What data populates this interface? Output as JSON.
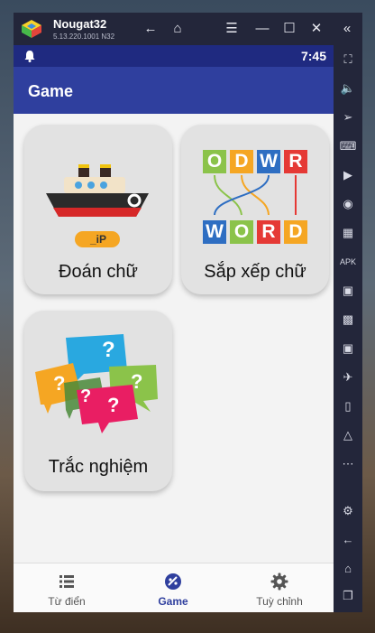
{
  "emulator": {
    "name": "Nougat32",
    "version": "5.13.220.1001 N32"
  },
  "status_bar": {
    "time": "7:45"
  },
  "app_bar": {
    "title": "Game"
  },
  "games": [
    {
      "label": "Đoán chữ",
      "icon": "ship-icon",
      "badge": "_iP"
    },
    {
      "label": "Sắp xếp chữ",
      "icon": "word-tiles-icon",
      "top_word": [
        "O",
        "D",
        "W",
        "R"
      ],
      "bottom_word": [
        "W",
        "O",
        "R",
        "D"
      ]
    },
    {
      "label": "Trắc nghiệm",
      "icon": "question-bubbles-icon",
      "marks": [
        "?",
        "?",
        "?",
        "?",
        "?"
      ]
    }
  ],
  "bottom_nav": [
    {
      "label": "Từ điển",
      "icon": "list-icon",
      "active": false
    },
    {
      "label": "Game",
      "icon": "game-icon",
      "active": true
    },
    {
      "label": "Tuỳ chỉnh",
      "icon": "gear-icon",
      "active": false
    }
  ],
  "colors": {
    "primary": "#2f3f9e",
    "status": "#1f2a80",
    "emulator": "#23263a"
  }
}
